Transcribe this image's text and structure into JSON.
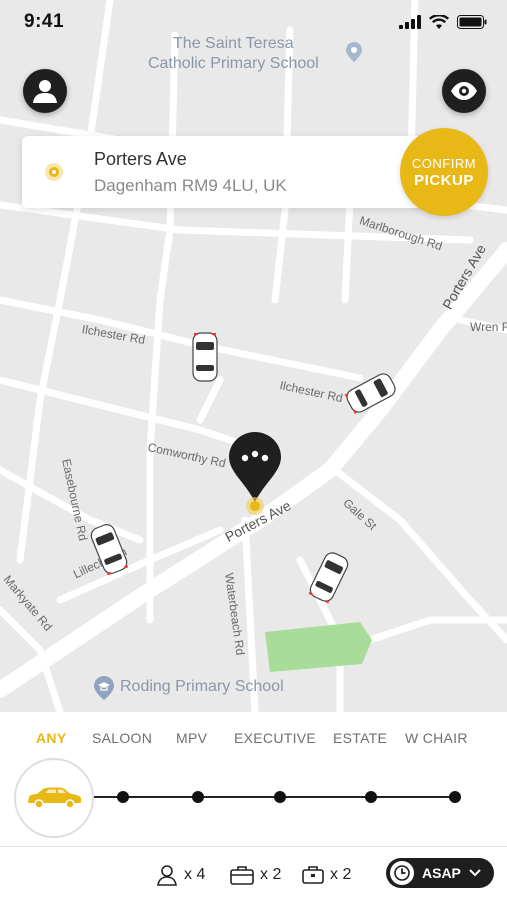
{
  "status_bar": {
    "time": "9:41"
  },
  "map": {
    "poi_top": "The Saint Teresa\nCatholic Primary School",
    "poi_top_line1": "The Saint Teresa",
    "poi_top_line2": "Catholic Primary School",
    "poi_bottom": "Roding Primary School",
    "roads": {
      "ilchester1": "Ilchester Rd",
      "ilchester2": "Ilchester Rd",
      "marlborough": "Marlborough Rd",
      "porters_ave_main": "Porters Ave",
      "porters_ave_pin": "Porters Ave",
      "wren": "Wren R",
      "comworthy": "Comworthy Rd",
      "gale": "Gale St",
      "waterbeach": "Waterbeach Rd",
      "easebourne": "Easebourne Rd",
      "lillechurch": "Lillechurch",
      "markyate": "Markyate Rd"
    }
  },
  "address": {
    "street": "Porters Ave",
    "area": "Dagenham RM9 4LU, UK"
  },
  "confirm_button": {
    "line1": "CONFIRM",
    "line2": "PICKUP"
  },
  "vehicle_tabs": [
    "ANY",
    "SALOON",
    "MPV",
    "EXECUTIVE",
    "ESTATE",
    "W CHAIR"
  ],
  "selected_tab": "ANY",
  "footer": {
    "passengers": "x 4",
    "luggage": "x 2",
    "hand_luggage": "x 2",
    "time_option": "ASAP"
  },
  "colors": {
    "accent": "#e8b817",
    "dark": "#1f1f1f"
  },
  "icons": [
    "profile-icon",
    "eye-icon",
    "location-dot-icon",
    "map-pin-icon",
    "car-icon",
    "passenger-icon",
    "suitcase-icon",
    "briefcase-icon",
    "clock-icon",
    "chevron-down-icon"
  ]
}
